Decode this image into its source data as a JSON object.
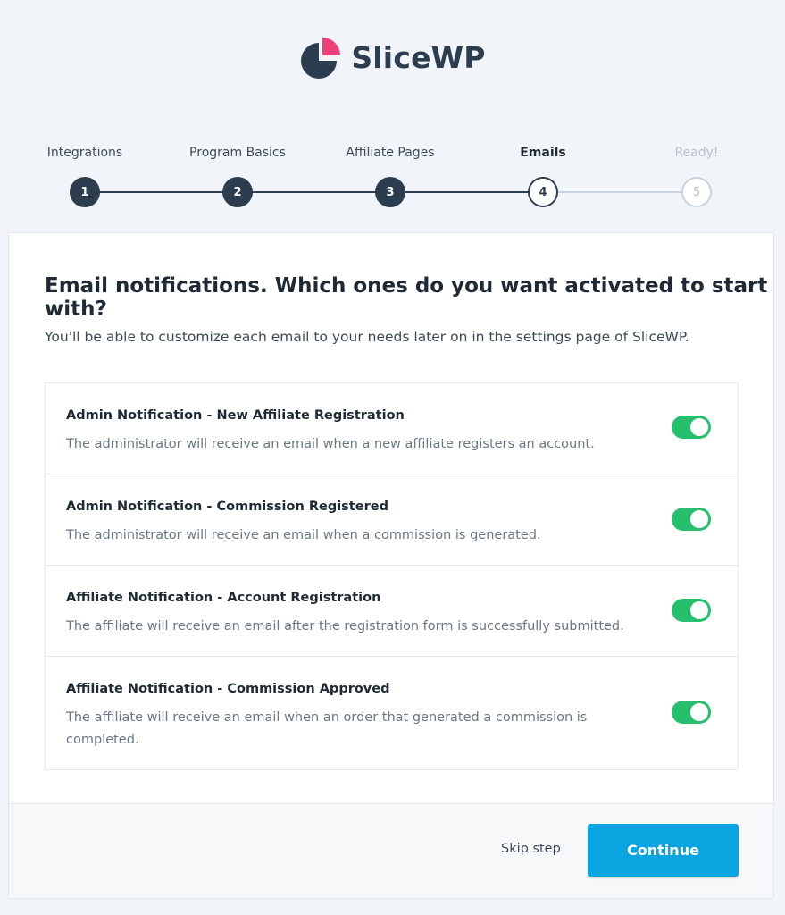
{
  "brand": {
    "name": "SliceWP",
    "dark_color": "#2c3d4f",
    "accent_color": "#ec407a"
  },
  "stepper": {
    "steps": [
      {
        "label": "Integrations",
        "number": "1",
        "state": "done"
      },
      {
        "label": "Program Basics",
        "number": "2",
        "state": "done"
      },
      {
        "label": "Affiliate Pages",
        "number": "3",
        "state": "done"
      },
      {
        "label": "Emails",
        "number": "4",
        "state": "active"
      },
      {
        "label": "Ready!",
        "number": "5",
        "state": "pending"
      }
    ]
  },
  "main": {
    "title": "Email notifications. Which ones do you want activated to start with?",
    "subtitle": "You'll be able to customize each email to your needs later on in the settings page of SliceWP.",
    "notifications": [
      {
        "title": "Admin Notification - New Affiliate Registration",
        "description": "The administrator will receive an email when a new affiliate registers an account.",
        "enabled": true
      },
      {
        "title": "Admin Notification - Commission Registered",
        "description": "The administrator will receive an email when a commission is generated.",
        "enabled": true
      },
      {
        "title": "Affiliate Notification - Account Registration",
        "description": "The affiliate will receive an email after the registration form is successfully submitted.",
        "enabled": true
      },
      {
        "title": "Affiliate Notification - Commission Approved",
        "description": "The affiliate will receive an email when an order that generated a commission is completed.",
        "enabled": true
      }
    ],
    "toggle_color": "#26c06c"
  },
  "footer": {
    "skip_label": "Skip step",
    "continue_label": "Continue",
    "continue_color": "#0aa5e0"
  }
}
